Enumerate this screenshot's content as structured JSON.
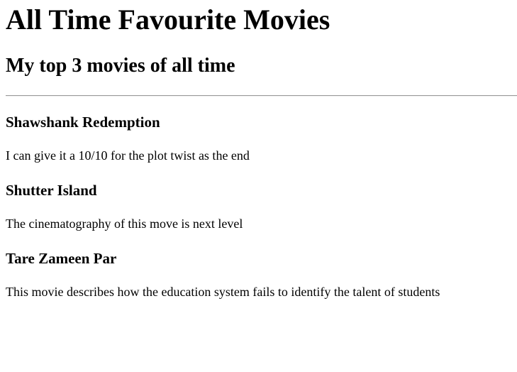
{
  "page_title": "All Time Favourite Movies",
  "subtitle": "My top 3 movies of all time",
  "movies": [
    {
      "title": "Shawshank Redemption",
      "review": "I can give it a 10/10 for the plot twist as the end"
    },
    {
      "title": "Shutter Island",
      "review": "The cinematography of this move is next level"
    },
    {
      "title": "Tare Zameen Par",
      "review": "This movie describes how the education system fails to identify the talent of students"
    }
  ]
}
